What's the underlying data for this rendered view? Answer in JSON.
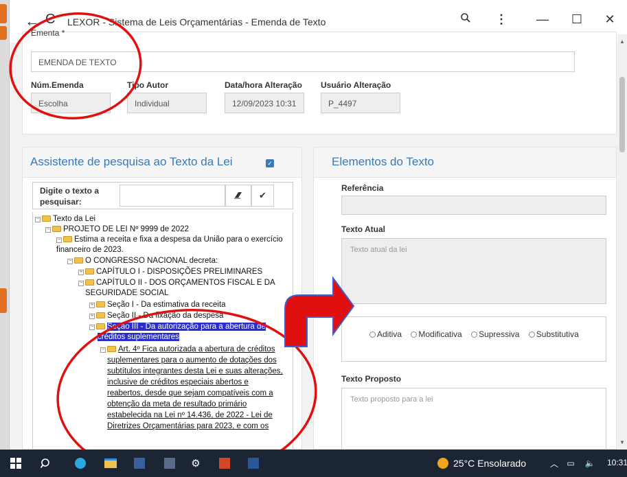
{
  "window": {
    "title": "LEXOR - Sistema de Leis Orçamentárias - Emenda de Texto",
    "back": "←",
    "reload": "C",
    "zoom_icon": "zoom-icon",
    "more_icon": "more-icon",
    "minimize": "—",
    "maximize": "☐",
    "close": "✕"
  },
  "form": {
    "ementa_label": "Ementa *",
    "ementa_value": "EMENDA DE TEXTO",
    "num_emenda_label": "Núm.Emenda",
    "num_emenda_value": "Escolha",
    "tipo_autor_label": "Tipo Autor",
    "tipo_autor_value": "Individual",
    "data_label": "Data/hora Alteração",
    "data_value": "12/09/2023 10:31",
    "usuario_label": "Usuário Alteração",
    "usuario_value": "P_4497"
  },
  "assistant": {
    "title": "Assistente de pesquisa ao Texto da Lei",
    "search_label": "Digite o texto a pesquisar:",
    "erase_icon": "eraser-icon",
    "confirm_icon": "check-icon",
    "tree": [
      {
        "text": "Texto da Lei"
      },
      {
        "text": "PROJETO DE LEI Nº 9999 de 2022"
      },
      {
        "text": "Estima a receita e fixa a despesa da União para o exercício"
      },
      {
        "text": "financeiro de 2023."
      },
      {
        "text": "O CONGRESSO NACIONAL decreta:"
      },
      {
        "text": "CAPÍTULO I - DISPOSIÇÕES PRELIMINARES"
      },
      {
        "text": "CAPÍTULO II - DOS ORÇAMENTOS FISCAL E DA"
      },
      {
        "text": "SEGURIDADE SOCIAL"
      },
      {
        "text": "Seção I - Da estimativa da receita"
      },
      {
        "text": "Seção II - Da fixação da despesa"
      },
      {
        "text": "Seção III - Da autorização para a abertura de"
      },
      {
        "text": "créditos suplementares"
      },
      {
        "text": "Art. 4º Fica autorizada a abertura de créditos"
      },
      {
        "text": "suplementares para o aumento de dotações dos"
      },
      {
        "text": "subtítulos integrantes desta Lei e suas alterações,"
      },
      {
        "text": "inclusive de créditos especiais abertos e"
      },
      {
        "text": "reabertos, desde que sejam compatíveis com a"
      },
      {
        "text": "obtenção da meta de resultado primário"
      },
      {
        "text": "estabelecida na Lei nº 14.436, de 2022 - Lei de"
      },
      {
        "text": "Diretrizes Orçamentárias para 2023, e com os"
      }
    ]
  },
  "elements": {
    "title": "Elementos do Texto",
    "referencia_label": "Referência",
    "texto_atual_label": "Texto Atual",
    "texto_atual_placeholder": "Texto atual da lei",
    "radios": [
      "Aditiva",
      "Modificativa",
      "Supressiva",
      "Substitutiva"
    ],
    "texto_proposto_label": "Texto Proposto",
    "texto_proposto_placeholder": "Texto proposto para a lei"
  },
  "taskbar": {
    "weather": "25°C  Ensolarado",
    "clock": "10:31"
  },
  "colors": {
    "accent": "#3a79b5",
    "annotation_red": "#e01010",
    "selection": "#2b2fc7",
    "taskbar": "#1b2533"
  }
}
